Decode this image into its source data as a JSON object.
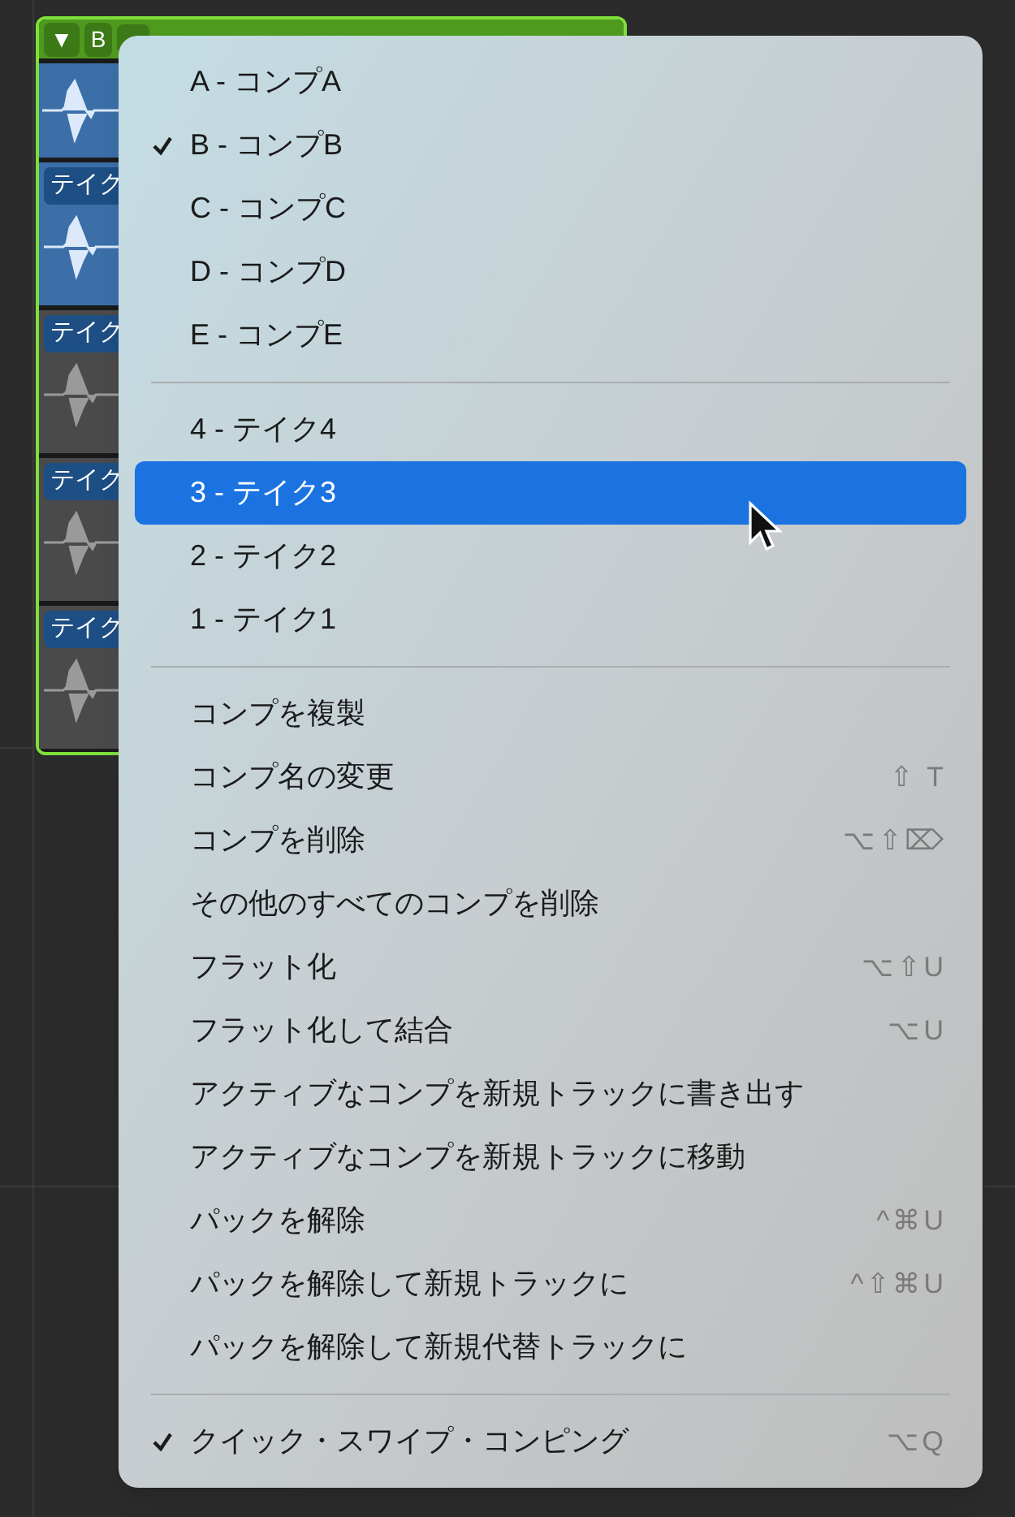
{
  "track": {
    "collapse": "▼",
    "comp_button": "B",
    "takes": [
      {
        "label": "テイク",
        "selected": true
      },
      {
        "label": "テイク",
        "selected": false
      },
      {
        "label": "テイク",
        "selected": false
      },
      {
        "label": "テイク",
        "selected": false
      }
    ]
  },
  "menu": {
    "sections": [
      [
        {
          "label": "A - コンプA",
          "checked": false,
          "selected": false
        },
        {
          "label": "B - コンプB",
          "checked": true,
          "selected": false
        },
        {
          "label": "C - コンプC",
          "checked": false,
          "selected": false
        },
        {
          "label": "D - コンプD",
          "checked": false,
          "selected": false
        },
        {
          "label": "E - コンプE",
          "checked": false,
          "selected": false
        }
      ],
      [
        {
          "label": "4 - テイク4",
          "checked": false,
          "selected": false
        },
        {
          "label": "3 - テイク3",
          "checked": false,
          "selected": true
        },
        {
          "label": "2 - テイク2",
          "checked": false,
          "selected": false
        },
        {
          "label": "1 - テイク1",
          "checked": false,
          "selected": false
        }
      ],
      [
        {
          "label": "コンプを複製",
          "checked": false,
          "selected": false
        },
        {
          "label": "コンプ名の変更",
          "checked": false,
          "selected": false,
          "shortcut": "⇧ T"
        },
        {
          "label": "コンプを削除",
          "checked": false,
          "selected": false,
          "shortcut": "⌥⇧⌦"
        },
        {
          "label": "その他のすべてのコンプを削除",
          "checked": false,
          "selected": false
        },
        {
          "label": "フラット化",
          "checked": false,
          "selected": false,
          "shortcut": "⌥⇧U"
        },
        {
          "label": "フラット化して結合",
          "checked": false,
          "selected": false,
          "shortcut": "⌥U"
        },
        {
          "label": "アクティブなコンプを新規トラックに書き出す",
          "checked": false,
          "selected": false
        },
        {
          "label": "アクティブなコンプを新規トラックに移動",
          "checked": false,
          "selected": false
        },
        {
          "label": "パックを解除",
          "checked": false,
          "selected": false,
          "shortcut": "^⌘U"
        },
        {
          "label": "パックを解除して新規トラックに",
          "checked": false,
          "selected": false,
          "shortcut": "^⇧⌘U"
        },
        {
          "label": "パックを解除して新規代替トラックに",
          "checked": false,
          "selected": false
        }
      ],
      [
        {
          "label": "クイック・スワイプ・コンピング",
          "checked": true,
          "selected": false,
          "shortcut": "⌥Q"
        }
      ]
    ]
  }
}
